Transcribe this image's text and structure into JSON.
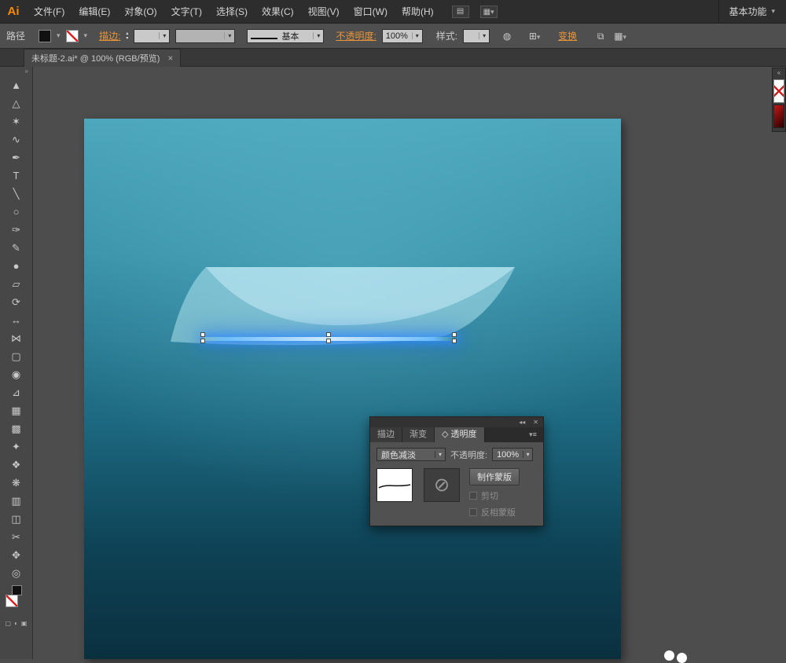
{
  "menubar": {
    "logo": "Ai",
    "items": [
      "文件(F)",
      "编辑(E)",
      "对象(O)",
      "文字(T)",
      "选择(S)",
      "效果(C)",
      "视图(V)",
      "窗口(W)",
      "帮助(H)"
    ],
    "workspace": "基本功能"
  },
  "controlbar": {
    "context_label": "路径",
    "stroke_link": "描边:",
    "brush_label": "基本",
    "opacity_link": "不透明度:",
    "opacity_value": "100%",
    "style_label": "样式:",
    "transform_link": "变换"
  },
  "tabbar": {
    "doc_title": "未标题-2.ai* @ 100% (RGB/预览)"
  },
  "tools": [
    {
      "name": "selection-tool",
      "glyph": "▲"
    },
    {
      "name": "direct-selection-tool",
      "glyph": "△"
    },
    {
      "name": "magic-wand-tool",
      "glyph": "✶"
    },
    {
      "name": "lasso-tool",
      "glyph": "∿"
    },
    {
      "name": "pen-tool",
      "glyph": "✒"
    },
    {
      "name": "type-tool",
      "glyph": "T"
    },
    {
      "name": "line-segment-tool",
      "glyph": "╲"
    },
    {
      "name": "ellipse-tool",
      "glyph": "○"
    },
    {
      "name": "paintbrush-tool",
      "glyph": "✑"
    },
    {
      "name": "pencil-tool",
      "glyph": "✎"
    },
    {
      "name": "blob-brush-tool",
      "glyph": "●"
    },
    {
      "name": "eraser-tool",
      "glyph": "▱"
    },
    {
      "name": "rotate-tool",
      "glyph": "⟳"
    },
    {
      "name": "scale-tool",
      "glyph": "↔"
    },
    {
      "name": "width-tool",
      "glyph": "⋈"
    },
    {
      "name": "free-transform-tool",
      "glyph": "▢"
    },
    {
      "name": "shape-builder-tool",
      "glyph": "◉"
    },
    {
      "name": "perspective-grid-tool",
      "glyph": "⊿"
    },
    {
      "name": "mesh-tool",
      "glyph": "▦"
    },
    {
      "name": "gradient-tool",
      "glyph": "▩"
    },
    {
      "name": "eyedropper-tool",
      "glyph": "✦"
    },
    {
      "name": "blend-tool",
      "glyph": "❖"
    },
    {
      "name": "symbol-sprayer-tool",
      "glyph": "❋"
    },
    {
      "name": "column-graph-tool",
      "glyph": "▥"
    },
    {
      "name": "artboard-tool",
      "glyph": "◫"
    },
    {
      "name": "slice-tool",
      "glyph": "✂"
    },
    {
      "name": "hand-tool",
      "glyph": "✥"
    },
    {
      "name": "zoom-tool",
      "glyph": "◎"
    }
  ],
  "panel": {
    "tabs": [
      "描边",
      "渐变",
      "透明度"
    ],
    "blend_mode": "颜色减淡",
    "opacity_label": "不透明度:",
    "opacity_value": "100%",
    "make_mask": "制作蒙版",
    "clip": "剪切",
    "invert_mask": "反相蒙版"
  },
  "icons": {
    "dropdown": "▾",
    "spin_up": "▴",
    "spin_down": "▾",
    "chevrons_right": "»",
    "chevrons_left": "«",
    "tab_close": "×",
    "panel_collapse": "◂◂",
    "panel_close": "✕",
    "panel_menu": "≡",
    "diamond": "◇",
    "prohibit": "⊘",
    "globe": "◍",
    "align_grid": "⊞",
    "transform_pair": "⧉",
    "document": "▤",
    "arrange": "▦",
    "mode_normal": "▢",
    "mode_behind": "◐",
    "mode_inside": "▣"
  },
  "colors": {
    "accent_orange": "#e8953a",
    "glow_blue": "#3aa0ff",
    "artboard_top": "#4ea8bd",
    "artboard_bottom": "#0a303f"
  }
}
